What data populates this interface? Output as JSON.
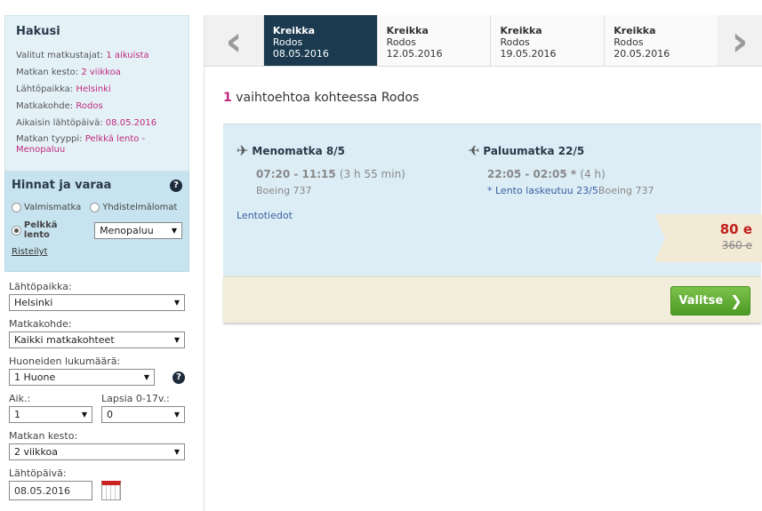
{
  "summary": {
    "title": "Hakusi",
    "rows": [
      {
        "label": "Valitut matkustajat:",
        "value": "1 aikuista"
      },
      {
        "label": "Matkan kesto:",
        "value": "2 viikkoa"
      },
      {
        "label": "Lähtöpaikka:",
        "value": "Helsinki"
      },
      {
        "label": "Matkakohde:",
        "value": "Rodos"
      },
      {
        "label": "Aikaisin lähtöpäivä:",
        "value": "08.05.2016"
      },
      {
        "label": "Matkan tyyppi:",
        "value": "Pelkkä lento - Menopaluu"
      }
    ]
  },
  "prices_box": {
    "title": "Hinnat ja varaa",
    "help_icon": "help-icon",
    "option_package": "Valmismatka",
    "option_combo": "Yhdistelmälomat",
    "option_flight": "Pelkkä lento",
    "flight_type_select": "Menopaluu",
    "cruises_link": "Risteilyt"
  },
  "form": {
    "departure_label": "Lähtöpaikka:",
    "departure_value": "Helsinki",
    "destination_label": "Matkakohde:",
    "destination_value": "Kaikki matkakohteet",
    "rooms_label": "Huoneiden lukumäärä:",
    "rooms_value": "1 Huone",
    "adults_label": "Aik.:",
    "adults_value": "1",
    "children_label": "Lapsia 0-17v.:",
    "children_value": "0",
    "duration_label": "Matkan kesto:",
    "duration_value": "2 viikkoa",
    "date_label": "Lähtöpäivä:",
    "date_value": "08.05.2016"
  },
  "date_tabs": [
    {
      "country": "Kreikka",
      "city": "Rodos",
      "date": "08.05.2016"
    },
    {
      "country": "Kreikka",
      "city": "Rodos",
      "date": "12.05.2016"
    },
    {
      "country": "Kreikka",
      "city": "Rodos",
      "date": "19.05.2016"
    },
    {
      "country": "Kreikka",
      "city": "Rodos",
      "date": "20.05.2016"
    }
  ],
  "results": {
    "count": "1",
    "text": "vaihtoehtoa kohteessa Rodos"
  },
  "flight": {
    "outbound": {
      "title": "Menomatka 8/5",
      "times": "07:20 - 11:15",
      "duration": "(3 h 55 min)",
      "aircraft": "Boeing 737"
    },
    "return": {
      "title": "Paluumatka 22/5",
      "times": "22:05 - 02:05 *",
      "duration": "(4 h)",
      "landing_note": "* Lento laskeutuu 23/5",
      "aircraft": "Boeing 737"
    },
    "details_link": "Lentotiedot",
    "price": "80 e",
    "old_price": "360 e",
    "select_button": "Valitse"
  },
  "colors": {
    "accent": "#c0297c",
    "active_tab": "#1b3a50",
    "price": "#c2201c",
    "button": "#5aa72e"
  }
}
